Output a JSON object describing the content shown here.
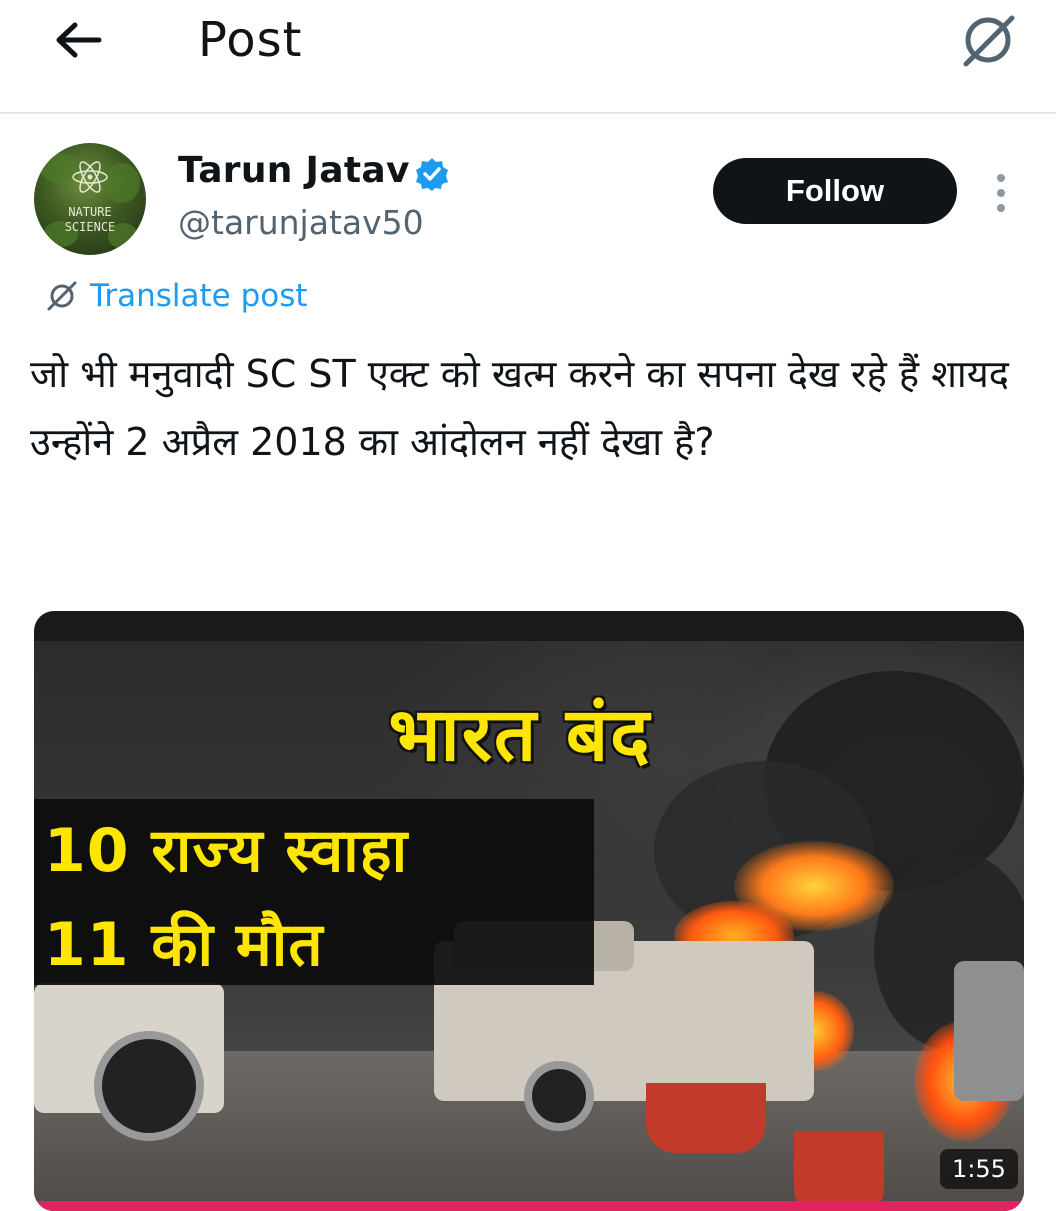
{
  "header": {
    "title": "Post"
  },
  "author": {
    "name": "Tarun Jatav",
    "handle": "@tarunjatav50",
    "avatar_text": [
      "NATURE",
      "SCIENCE"
    ],
    "verified": true
  },
  "actions": {
    "follow_label": "Follow"
  },
  "post": {
    "translate_label": "Translate post",
    "text": "जो भी मनुवादी SC ST एक्ट को खत्म करने का सपना देख रहे हैं शायद उन्होंने 2 अप्रैल 2018 का आंदोलन नहीं देखा है?"
  },
  "media": {
    "headline": "भारत बंद",
    "line1": "10 राज्य स्वाहा",
    "line2": "11 की मौत",
    "duration": "1:55"
  },
  "colors": {
    "accent": "#1d9bf0",
    "text": "#0f1419",
    "muted": "#536471",
    "follow_bg": "#0f1419",
    "headline_yellow": "#ffe600"
  },
  "icons": {
    "back": "arrow-left-icon",
    "translate_top": "translate-icon",
    "translate_inline": "translate-icon",
    "verified": "verified-badge-icon",
    "more": "more-vertical-icon"
  }
}
